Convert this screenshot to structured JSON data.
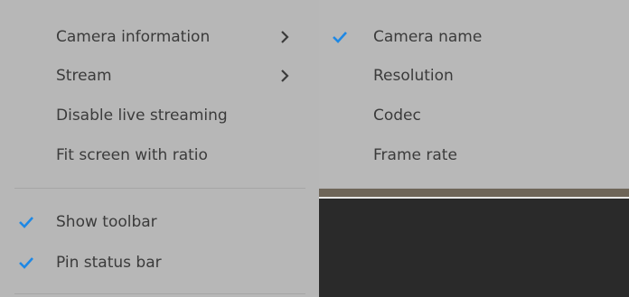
{
  "menu": {
    "items": [
      {
        "label": "Camera information",
        "has_submenu": true
      },
      {
        "label": "Stream",
        "has_submenu": true
      },
      {
        "label": "Disable live streaming",
        "has_submenu": false
      },
      {
        "label": "Fit screen with ratio",
        "has_submenu": false
      }
    ],
    "toggles": [
      {
        "label": "Show toolbar",
        "checked": true
      },
      {
        "label": "Pin status bar",
        "checked": true
      }
    ]
  },
  "submenu": {
    "items": [
      {
        "label": "Camera name",
        "checked": true
      },
      {
        "label": "Resolution",
        "checked": false
      },
      {
        "label": "Codec",
        "checked": false
      },
      {
        "label": "Frame rate",
        "checked": false
      }
    ]
  },
  "colors": {
    "menu_bg": "#b7b7b7",
    "text": "#3b3b3b",
    "check": "#1e88e5",
    "video_bg": "#2a2a2a"
  },
  "icons": {
    "check": "check-icon",
    "submenu_arrow": "chevron-right-icon"
  }
}
